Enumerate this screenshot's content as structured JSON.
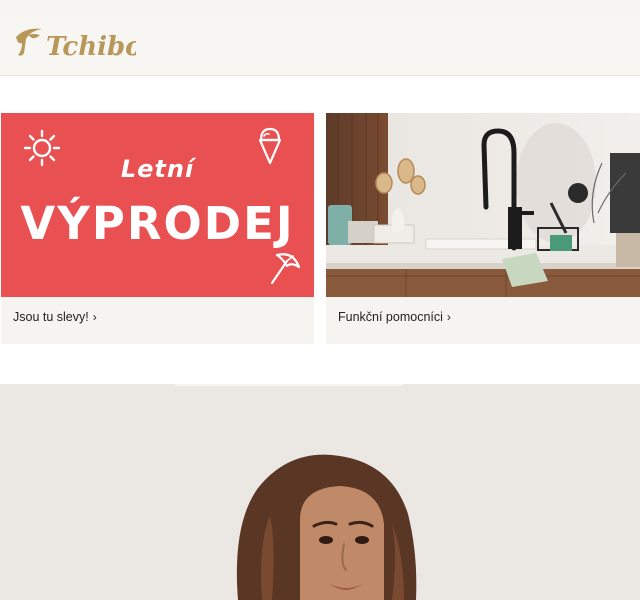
{
  "brand": {
    "name": "Tchibo"
  },
  "colors": {
    "brand_gold": "#b8975a",
    "sale_red": "#e95052",
    "header_bg": "#f8f6f2"
  },
  "promo_cards": [
    {
      "headline_small": "Letní",
      "headline_big": "VÝPRODEJ",
      "caption": "Jsou tu slevy!",
      "icons": [
        "sun-icon",
        "ice-cream-icon",
        "umbrella-icon"
      ]
    },
    {
      "caption": "Funkční pomocníci",
      "image": "kitchen-faucet-photo"
    }
  ],
  "hero": {
    "image": "woman-portrait-photo"
  },
  "icons": {
    "chevron": "›"
  }
}
